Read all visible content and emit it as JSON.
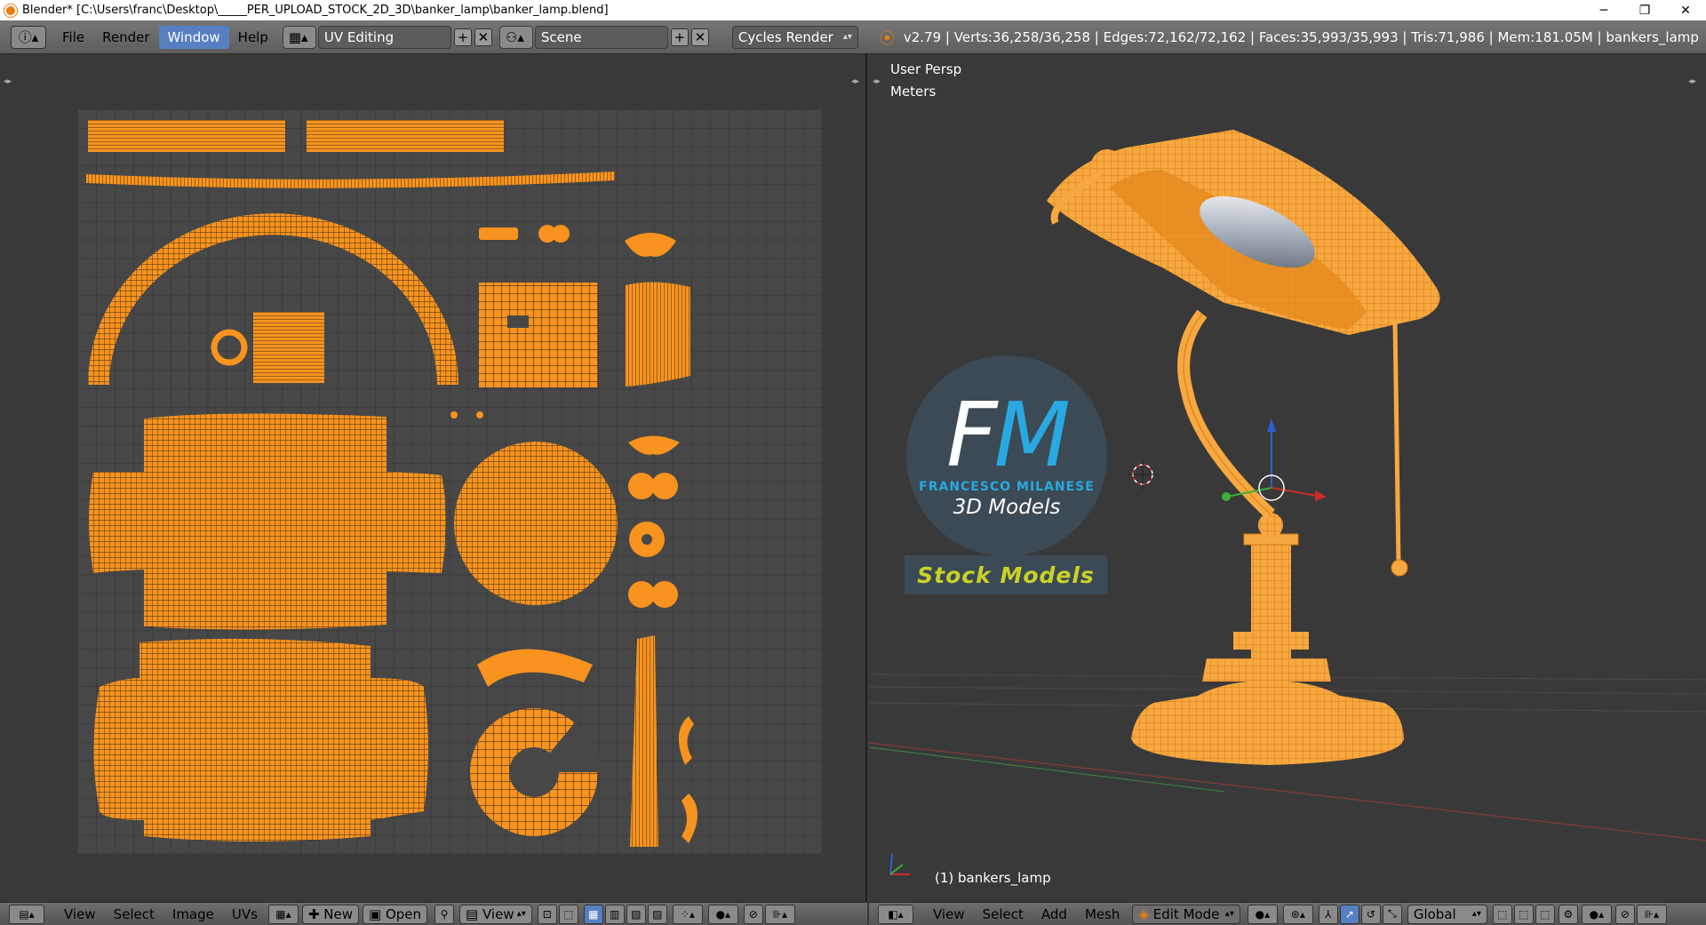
{
  "window": {
    "title": "Blender* [C:\\Users\\franc\\Desktop\\_____PER_UPLOAD_STOCK_2D_3D\\banker_lamp\\banker_lamp.blend]",
    "minimize_label": "─",
    "restore_label": "❐",
    "close_label": "✕"
  },
  "topbar": {
    "menus": [
      "File",
      "Render",
      "Window",
      "Help"
    ],
    "active_menu": "Window",
    "layout": "UV Editing",
    "scene": "Scene",
    "engine": "Cycles Render",
    "stats": "v2.79 | Verts:36,258/36,258 | Edges:72,162/72,162 | Faces:35,993/35,993 | Tris:71,986 | Mem:181.05M | bankers_lamp",
    "accent_color": "#5680c2"
  },
  "uv_editor": {
    "menus": [
      "View",
      "Select",
      "Image",
      "UVs"
    ],
    "new_label": "New",
    "open_label": "Open",
    "view_label": "View",
    "uv_color": "#f7931e"
  },
  "viewport": {
    "view_name": "User Persp",
    "units": "Meters",
    "object_label": "(1) bankers_lamp",
    "menus": [
      "View",
      "Select",
      "Add",
      "Mesh"
    ],
    "mode": "Edit Mode",
    "orientation": "Global"
  },
  "logo": {
    "letter_f": "F",
    "letter_m": "M",
    "name": "FRANCESCO MILANESE",
    "tagline": "3D Models",
    "badge": "Stock Models",
    "accent_color": "#29a9e1",
    "badge_color": "#c8d22a"
  }
}
